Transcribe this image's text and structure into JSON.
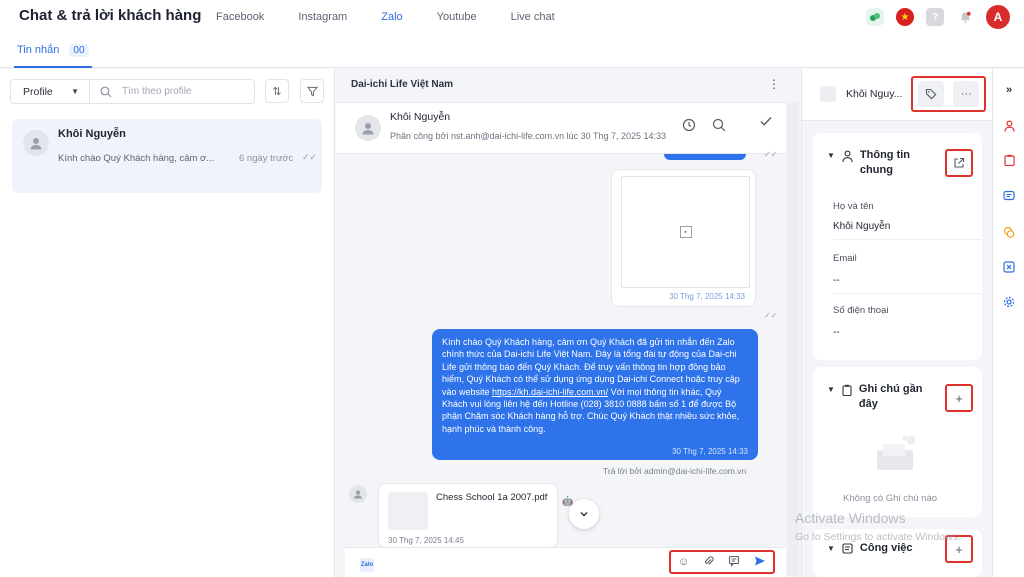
{
  "header": {
    "title": "Chat & trả lời khách hàng",
    "nav": [
      {
        "label": "Facebook",
        "active": false
      },
      {
        "label": "Instagram",
        "active": false
      },
      {
        "label": "Zalo",
        "active": true
      },
      {
        "label": "Youtube",
        "active": false
      },
      {
        "label": "Live chat",
        "active": false
      }
    ],
    "help_label": "?",
    "avatar_initial": "A"
  },
  "tabs": {
    "label": "Tin nhắn",
    "count": "00"
  },
  "left": {
    "profile_select": "Profile",
    "search_placeholder": "Tìm theo profile",
    "conversation": {
      "name": "Khôi Nguyễn",
      "preview": "Kính chào Quý Khách hàng, cảm ơ...",
      "time": "6 ngày trước"
    }
  },
  "chat": {
    "page_title": "Dai-ichi Life Việt Nam",
    "contact_name": "Khôi Nguyễn",
    "assigned": "Phân công bởi nst.anh@dai-ichi-life.com.vn lúc 30 Thg 7, 2025 14:33",
    "image_msg_time": "30 Thg 7, 2025 14:33",
    "blue_msg": {
      "part1": "Kính chào Quý Khách hàng, cảm ơn Quý Khách đã gửi tin nhắn đến Zalo chính thức của Dai-ichi Life Việt Nam. Đây là tổng đài tự động của Dai-chi Life gửi thông báo đến Quý Khách. Để truy vấn thông tin hợp đồng bảo hiểm, Quý Khách có thể sử dụng ứng dụng Dai-ichi Connect hoặc truy cập vào website ",
      "link": "https://kh.dai-ichi-life.com.vn/",
      "part2": " Với mọi thông tin khác, Quý Khách vui lòng liên hệ đến Hotline (028) 3810 0888 bấm số 1 để được Bộ phận Chăm sóc Khách hàng hỗ trợ. Chúc Quý Khách thật nhiều sức khỏe, hạnh phúc và thành công.",
      "time": "30 Thg 7, 2025 14:33"
    },
    "reply_by": "Trả lời bởi admin@dai-ichi-life.com.vn",
    "file_msg": {
      "name": "Chess School 1a 2007.pdf",
      "time": "30 Thg 7, 2025 14:45"
    },
    "composer_badge": "Zalo"
  },
  "right": {
    "contact_name": "Khôi Nguy...",
    "general": {
      "title": "Thông tin chung",
      "fields": [
        {
          "label": "Họ và tên",
          "value": "Khôi Nguyễn"
        },
        {
          "label": "Email",
          "value": "--"
        },
        {
          "label": "Số điện thoại",
          "value": "--"
        }
      ]
    },
    "notes": {
      "title": "Ghi chú gần đây",
      "empty": "Không có Ghi chú nào"
    },
    "tasks": {
      "title": "Công việc"
    }
  },
  "watermark": {
    "title": "Activate Windows",
    "sub": "Go to Settings to activate Windows."
  },
  "colors": {
    "accent": "#2e6fe0",
    "bubble": "#2e73ea",
    "highlight": "#e0322d"
  }
}
